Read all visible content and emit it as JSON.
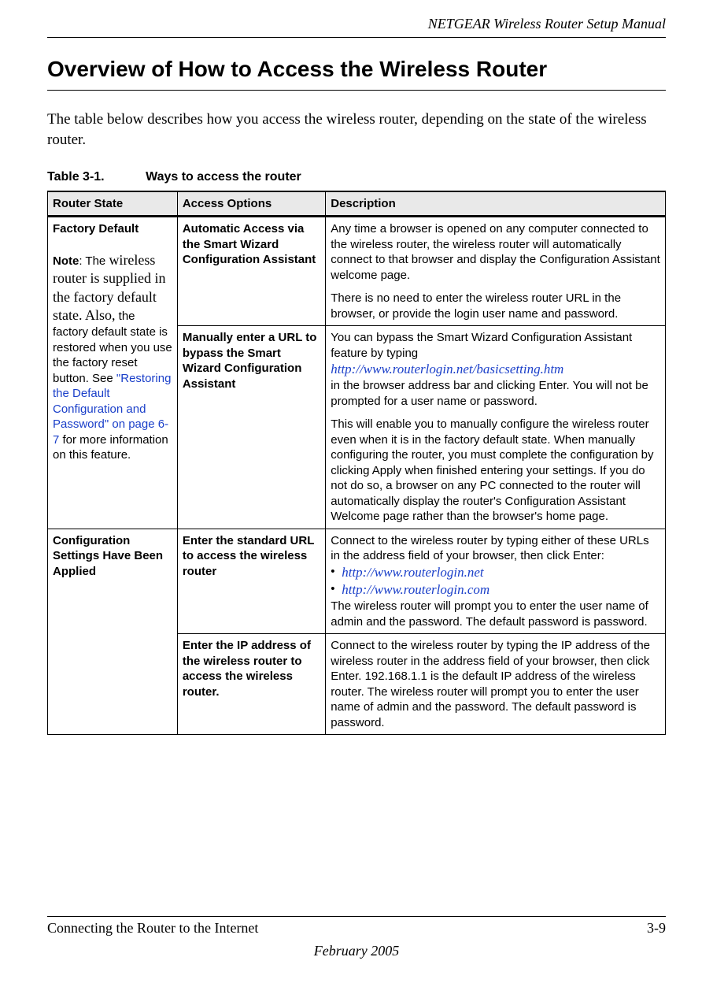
{
  "header": {
    "doc_title": "NETGEAR Wireless Router Setup Manual"
  },
  "page": {
    "heading": "Overview of How to Access the Wireless Router",
    "intro": "The table below describes how you access the wireless router, depending on the state of the wireless router."
  },
  "table": {
    "caption_num": "Table 3-1.",
    "caption_text": "Ways to access the router",
    "headers": {
      "col1": "Router State",
      "col2": "Access Options",
      "col3": "Description"
    },
    "rows": {
      "r1": {
        "state_title": "Factory Default",
        "state_note_label": "Note",
        "state_note_lead": ": The ",
        "state_note_serif": "wireless router is supplied in the factory default state. Also,",
        "state_note_tail": " the factory default state is restored when you use the factory reset button. See ",
        "state_note_link": "\"Restoring the Default Configuration and Password\" on page 6-7",
        "state_note_end": " for more information on this feature.",
        "opt": "Automatic Access via the Smart Wizard Configuration Assistant",
        "desc_p1": "Any time a browser is opened on any computer connected to the wireless router, the wireless router will automatically connect to that browser and display the Configuration Assistant welcome page.",
        "desc_p2": "There is no need to enter the wireless router URL in the browser, or provide the login user name and password."
      },
      "r2": {
        "opt": "Manually enter a URL to bypass the Smart Wizard Configuration Assistant",
        "desc_p1a": "You can bypass the Smart Wizard Configuration Assistant feature by typing",
        "desc_url": "http://www.routerlogin.net/basicsetting.htm",
        "desc_p1b": "in the browser address bar and clicking Enter. You will not be prompted for a user name or password.",
        "desc_p2": "This will enable you to manually configure the wireless router even when it is in the factory default state. When manually configuring the router, you must complete the configuration by clicking Apply when finished entering your settings. If you do not do so, a browser on any PC connected to the router will automatically display the router's Configuration Assistant Welcome page rather than the browser's home page."
      },
      "r3": {
        "state": "Configuration Settings Have Been Applied",
        "opt": "Enter the standard URL to access the wireless router",
        "desc_lead": "Connect to the wireless router by typing either of these URLs in the address field of your browser, then click Enter:",
        "bullet1": "http://www.routerlogin.net",
        "bullet2": "http://www.routerlogin.com",
        "desc_tail": "The wireless router will prompt you to enter the user name of admin and the password. The default password is password."
      },
      "r4": {
        "opt": "Enter the IP address of the wireless router to access the wireless router.",
        "desc": "Connect to the wireless router by typing the IP address of the wireless router in the address field of your browser, then click Enter. 192.168.1.1 is the default IP address of the wireless router. The wireless router will prompt you to enter the user name of admin and the password. The default password is password."
      }
    }
  },
  "footer": {
    "section": "Connecting the Router to the Internet",
    "pagenum": "3-9",
    "date": "February 2005"
  }
}
